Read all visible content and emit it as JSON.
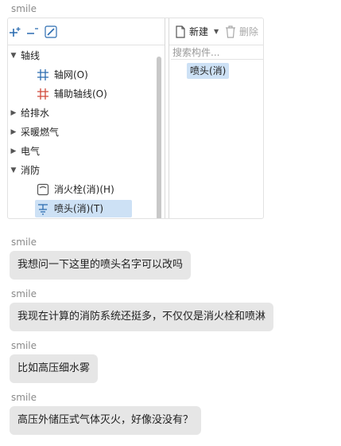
{
  "messages": [
    {
      "sender": "smile",
      "type": "image"
    },
    {
      "sender": "smile",
      "text": "我想问一下这里的喷头名字可以改吗"
    },
    {
      "sender": "smile",
      "text": "我现在计算的消防系统还挺多，不仅仅是消火栓和喷淋"
    },
    {
      "sender": "smile",
      "text": "比如高压细水雾"
    },
    {
      "sender": "smile",
      "text": "高压外储压式气体灭火，好像没没有？"
    }
  ],
  "screenshot": {
    "tree": [
      {
        "label": "轴线",
        "expanded": true
      },
      {
        "label": "轴网(O)",
        "icon": "grid-icon"
      },
      {
        "label": "辅助轴线(O)",
        "icon": "grid-icon"
      },
      {
        "label": "给排水",
        "expanded": false
      },
      {
        "label": "采暖燃气",
        "expanded": false
      },
      {
        "label": "电气",
        "expanded": false
      },
      {
        "label": "消防",
        "expanded": true
      },
      {
        "label": "消火栓(消)(H)",
        "icon": "hydrant-icon"
      },
      {
        "label": "喷头(消)(T)",
        "icon": "sprinkler-icon",
        "selected": true
      }
    ],
    "right_pane": {
      "new_label": "新建",
      "delete_label": "删除",
      "search_placeholder": "搜索构件...",
      "component": "喷头(消)"
    },
    "colors": {
      "selection": "#cde1f5",
      "icon_blue": "#2b6cb0",
      "bubble": "#e6e6e6"
    }
  }
}
